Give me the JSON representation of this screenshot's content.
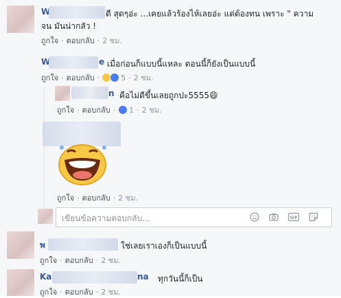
{
  "comments": [
    {
      "id": "c1",
      "name_prefix": "W",
      "text_line1": "ดี สุดๆอ่ะ ...เคยแล้วร้องไห้เลยอ่ะ แต่ต้องทน เพราะ \" ความ",
      "text_line2": "จน มันน่ากลัว !",
      "like": "ถูกใจ",
      "reply": "ตอบกลับ",
      "time": "2 ชม."
    },
    {
      "id": "c2",
      "name_prefix": "W",
      "name_suffix": "e",
      "text": "เมื่อก่อนก็แบบนี้แหละ ตอนนี้ก็ยังเป็นแบบนี้",
      "like": "ถูกใจ",
      "reply": "ตอบกลับ",
      "reaction_count": "5",
      "time": "2 ชม."
    },
    {
      "id": "r1",
      "name_suffix": "n",
      "text": "คือไม่ดีขึ้นเลยถูกปะ5555😄",
      "like": "ถูกใจ",
      "reply": "ตอบกลับ",
      "reaction_count": "1",
      "time": "2 ชม."
    },
    {
      "id": "r2",
      "like": "ถูกใจ",
      "reply": "ตอบกลับ",
      "time": "2 ชม."
    },
    {
      "id": "c3",
      "name_prefix": "พ",
      "text": "ใช่เลยเราเองก็เป็นแบบนี้",
      "like": "ถูกใจ",
      "reply": "ตอบกลับ",
      "time": "2 ชม."
    },
    {
      "id": "c4",
      "name_prefix": "Ka",
      "name_suffix": "na",
      "text": "ทุกวันนี้ก็เป็น",
      "like": "ถูกใจ",
      "reply": "ตอบกลับ",
      "time": "2 ชม."
    }
  ],
  "reply_box": {
    "placeholder": "เขียนข้อความตอบกลับ..."
  },
  "sep": "·",
  "colors": {
    "link": "#365899",
    "meta": "#90949c",
    "text": "#1d2129"
  }
}
